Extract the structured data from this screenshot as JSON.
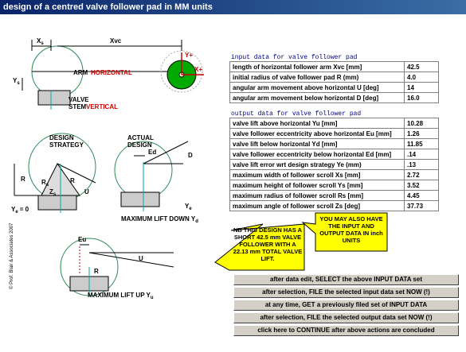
{
  "window": {
    "title": "design of a centred valve follower pad in MM units"
  },
  "input_section": {
    "header": "input data for valve follower pad",
    "rows": [
      {
        "label": "length of horizontal follower arm Xvc [mm]",
        "value": "42.5"
      },
      {
        "label": "initial radius of valve follower pad R (mm)",
        "value": "4.0"
      },
      {
        "label": "angular arm movement above horizontal U [deg]",
        "value": "14"
      },
      {
        "label": "angular arm movement below horizontal D [deg]",
        "value": "16.0"
      }
    ]
  },
  "output_section": {
    "header": "output data for valve follower pad",
    "rows": [
      {
        "label": "valve lift above horizontal Yu [mm]",
        "value": "10.28"
      },
      {
        "label": "valve follower eccentricity above horizontal Eu [mm]",
        "value": "1.26"
      },
      {
        "label": "valve lift below horizontal Yd [mm]",
        "value": "11.85"
      },
      {
        "label": "valve follower eccentricity below horizontal Ed [mm]",
        "value": ".14"
      },
      {
        "label": "valve lift error wrt design strategy Ye (mm)",
        "value": ".13"
      },
      {
        "label": "maximum width of follower scroll Xs [mm]",
        "value": "2.72"
      },
      {
        "label": "maximum height of follower scroll Ys [mm]",
        "value": "3.52"
      },
      {
        "label": "maximum radius of follower scroll Rs [mm]",
        "value": "4.45"
      },
      {
        "label": "maximum angle of follower scroll Zs [deg]",
        "value": "37.73"
      }
    ]
  },
  "callouts": {
    "note_design": "NB THIS DESIGN HAS A SHORT 42.5 mm VALVE FOLLOWER WITH A 22.13 mm TOTAL VALVE LIFT.",
    "note_units": "YOU MAY ALSO HAVE THE INPUT AND OUTPUT DATA IN inch UNITS"
  },
  "buttons": {
    "select_input": "after data edit, SELECT the above INPUT DATA set",
    "file_input": "after selection, FILE the selected input data set NOW (!)",
    "get_input": "at any time, GET a previously filed set of INPUT DATA",
    "file_output": "after selection, FILE the selected output data set NOW (!)",
    "continue": "click here to CONTINUE after above actions are concluded"
  },
  "diagram": {
    "xs": "X",
    "xs_sub": "s",
    "xvc": "Xvc",
    "yplus": "Y+",
    "xplus": "X+",
    "ys": "Y",
    "ys_sub": "s",
    "arm": "ARM",
    "horizontal": "HORIZONTAL",
    "valve": "VALVE",
    "stem": "STEM",
    "vertical": "VERTICAL",
    "design_strategy_1": "DESIGN",
    "design_strategy_2": "STRATEGY",
    "actual_design_1": "ACTUAL",
    "actual_design_2": "DESIGN",
    "r": "R",
    "rs": "R",
    "rs_sub": "s",
    "zs": "Z",
    "zs_sub": "s",
    "u": "U",
    "d": "D",
    "ed": "Ed",
    "ye0": "Y",
    "ye0_sub": "e",
    "ye0_val": "= 0",
    "ye": "Y",
    "ye_sub": "e",
    "max_lift_down": "MAXIMUM LIFT DOWN Y",
    "max_lift_down_sub": "d",
    "eu": "Eu",
    "max_lift_up": "MAXIMUM LIFT UP Y",
    "max_lift_up_sub": "u",
    "copyright": "© Prof. Blair & Associates 2007"
  },
  "colors": {
    "accent_red": "#cc0000",
    "callout_yellow": "#ffff00",
    "green": "#00aa00"
  }
}
